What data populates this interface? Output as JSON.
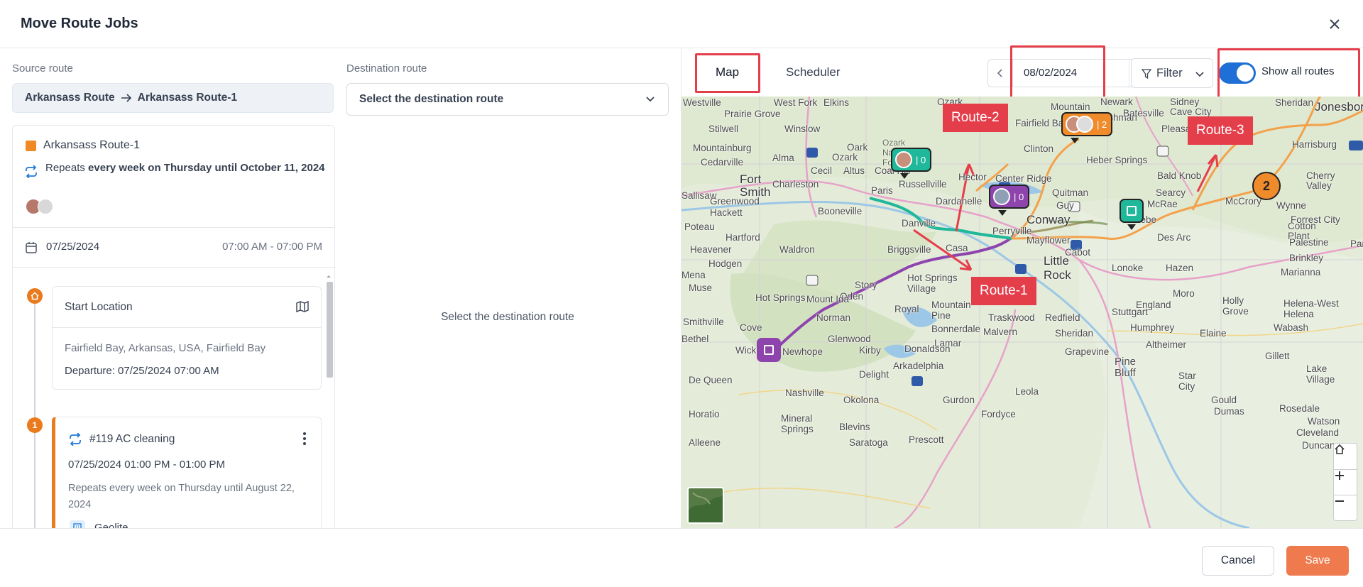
{
  "modal": {
    "title": "Move Route Jobs"
  },
  "source": {
    "label": "Source route",
    "from": "Arkansass Route",
    "to": "Arkansass Route-1",
    "route_name": "Arkansass Route-1",
    "route_color": "#f08a24",
    "repeat_prefix": "Repeats ",
    "repeat_bold": "every week on Thursday until October 11, 2024",
    "date": "07/25/2024",
    "time_range": "07:00 AM - 07:00 PM",
    "start": {
      "title": "Start Location",
      "address": "Fairfield Bay, Arkansas, USA, Fairfield Bay",
      "departure": "Departure: 07/25/2024 07:00 AM"
    },
    "job": {
      "number": "1",
      "title": "#119 AC cleaning",
      "time": "07/25/2024 01:00 PM - 01:00 PM",
      "repeat": "Repeats every week on Thursday until August 22, 2024",
      "company": "Geolite"
    }
  },
  "destination": {
    "label": "Destination route",
    "select_placeholder": "Select the destination route",
    "empty_text": "Select the destination route"
  },
  "map_panel": {
    "tabs": {
      "map": "Map",
      "scheduler": "Scheduler"
    },
    "date": "08/02/2024",
    "filter": "Filter",
    "show_all_routes": "Show all routes",
    "show_all_routes_on": true,
    "callouts": {
      "route1": "Route-1",
      "route2": "Route-2",
      "route3": "Route-3"
    },
    "markers": {
      "green_count": "| 0",
      "purple_count": "| 0",
      "orange_count": "| 2",
      "stop_number": "2"
    },
    "places": [
      "Westville",
      "West Fork",
      "Elkins",
      "Mountain",
      "Cushman",
      "Sidney",
      "Cave City",
      "Sheridan",
      "Prairie Grove",
      "Winslow",
      "Ozark",
      "Oark",
      "Fairfield Bay",
      "Batesville",
      "Stilwell",
      "Ozark National Forest",
      "Pleasant Plains",
      "Newark",
      "Jonesboro",
      "Mountainburg",
      "Cedarville",
      "Alma",
      "Ozark",
      "Hector",
      "Clinton",
      "Heber Springs",
      "Bald Knob",
      "Harrisburg",
      "Cecil",
      "Altus",
      "Coal Hill",
      "Center Ridge",
      "Quitman",
      "Searcy",
      "Cherry Valley",
      "Fort Smith",
      "Charleston",
      "Paris",
      "Russellville",
      "Guy",
      "Wynne",
      "Sallisaw",
      "Greenwood",
      "Dardanelle",
      "McRae",
      "McCrory",
      "Booneville",
      "Conway",
      "Beebe",
      "Cotton Plant",
      "Forrest City",
      "Hackett",
      "Danville",
      "Perryville",
      "Mayflower",
      "Parkin",
      "Poteau",
      "Hartford",
      "Cabot",
      "Des Arc",
      "Palestine",
      "Waldron",
      "Casa",
      "Briggsville",
      "Brinkley",
      "Hodgen",
      "Heavener",
      "Little Rock",
      "Lonoke",
      "Hazen",
      "Marianna",
      "Mena",
      "Story",
      "Hot Springs Village",
      "England",
      "Holly Grove",
      "Oden",
      "Mount Ida",
      "Royal",
      "Mountain Pine",
      "Stuttgart",
      "Moro",
      "Norman",
      "Bonnerdale",
      "Traskwood",
      "Redfield",
      "Helena-West Helena",
      "Smithville",
      "Cove",
      "Malvern",
      "Sheridan",
      "Humphrey",
      "Elaine",
      "Bethel",
      "Glenwood",
      "Lamar",
      "Wabash",
      "Wickes",
      "Newhope",
      "Kirby",
      "Donaldson",
      "Grapevine",
      "Altheimer",
      "Gillett",
      "Arkadelphia",
      "Delight",
      "Pine Bluff",
      "Star City",
      "Lake Village",
      "De Queen",
      "Nashville",
      "Okolona",
      "Gurdon",
      "Leola",
      "Gould",
      "Dumas",
      "Rosedale",
      "Horatio",
      "Mineral Springs",
      "Blevins",
      "Fordyce",
      "Watson",
      "Cleveland",
      "Alleene",
      "Saratoga",
      "Prescott",
      "Duncan",
      "Muse",
      "Hot Springs"
    ]
  },
  "footer": {
    "cancel": "Cancel",
    "save": "Save"
  },
  "colors": {
    "accent": "#ee7a4e",
    "toggle": "#1f6fd6",
    "route_orange": "#ea7a1c",
    "route_green": "#1fb89a",
    "route_purple": "#8e44ad",
    "highlight": "#e53e4b"
  }
}
